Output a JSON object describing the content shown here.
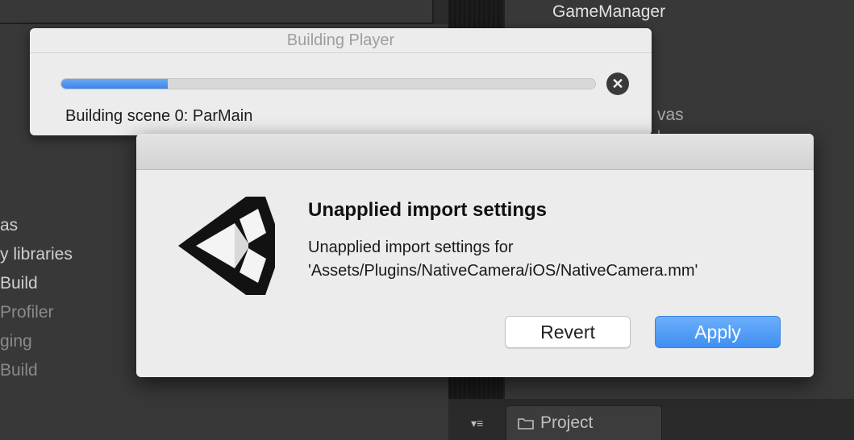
{
  "hierarchy": {
    "items": [
      "GameManager",
      "vas",
      "'"
    ]
  },
  "left_panel": {
    "items": [
      "as",
      "y libraries",
      " Build",
      " Profiler",
      "ging",
      "Build"
    ]
  },
  "bottom": {
    "project_tab_label": "Project",
    "menu_icon_glyph": "▾≡"
  },
  "build_window": {
    "title": "Building Player",
    "progress": 0.2,
    "cancel_glyph": "✕",
    "status": "Building scene 0: ParMain"
  },
  "dialog": {
    "heading": "Unapplied import settings",
    "message": "Unapplied import settings for 'Assets/Plugins/NativeCamera/iOS/NativeCamera.mm'",
    "revert_label": "Revert",
    "apply_label": "Apply",
    "icon": "unity-logo-icon"
  },
  "colors": {
    "accent": "#3f8ef2",
    "progress": "#4a8ff0",
    "editor_bg": "#383838"
  }
}
